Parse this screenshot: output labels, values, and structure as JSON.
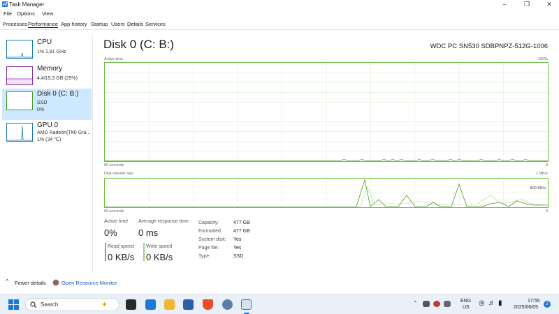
{
  "window": {
    "title": "Task Manager"
  },
  "menu": [
    "File",
    "Options",
    "View"
  ],
  "tabs": [
    "Processes",
    "Performance",
    "App history",
    "Startup",
    "Users",
    "Details",
    "Services"
  ],
  "sidebar": {
    "items": [
      {
        "name": "CPU",
        "lines": [
          "1%  1,81 GHz"
        ],
        "color": "#1779ba"
      },
      {
        "name": "Memory",
        "lines": [
          "4,4/15,3 GB (29%)"
        ],
        "color": "#8b2fa6"
      },
      {
        "name": "Disk 0 (C: B:)",
        "lines": [
          "SSD",
          "0%"
        ],
        "color": "#4e9a2a"
      },
      {
        "name": "GPU 0",
        "lines": [
          "AMD Radeon(TM) Gra...",
          "1%  (34 °C)"
        ],
        "color": "#1779ba"
      }
    ]
  },
  "disk": {
    "title": "Disk 0 (C: B:)",
    "model": "WDC PC SN530 SDBPNPZ-512G-1006",
    "active_graph": {
      "label": "Active time",
      "max_label": "100%",
      "min_label": "0",
      "time_label": "60 seconds",
      "values": [
        0,
        0,
        0,
        0,
        0,
        0,
        0,
        0,
        0,
        0,
        0,
        0,
        0,
        0,
        0,
        0,
        0,
        0,
        0,
        0,
        0,
        0,
        0,
        0,
        0,
        0,
        0,
        0,
        0,
        0,
        0,
        0,
        0,
        0,
        0,
        0,
        0,
        0,
        0,
        0,
        0,
        0,
        0,
        0,
        0,
        0,
        0,
        0,
        0,
        0,
        0,
        0,
        0,
        0,
        1,
        0,
        0,
        0,
        1,
        0,
        0,
        0,
        0,
        1,
        0,
        1,
        0,
        1,
        0,
        0,
        0,
        1,
        0,
        0,
        1,
        0,
        0,
        0,
        1,
        0,
        1,
        0,
        0,
        0,
        0,
        1,
        0,
        0,
        0,
        1,
        0,
        0,
        1,
        0,
        0,
        1,
        0,
        0,
        0,
        0,
        0
      ]
    },
    "transfer_graph": {
      "label": "Disk transfer rate",
      "max_label": "1 MB/s",
      "mid_label": "800 KB/s",
      "min_label": "0",
      "time_label": "60 seconds"
    },
    "stats": {
      "active_time_label": "Active time",
      "active_time_value": "0%",
      "avg_response_label": "Average response time",
      "avg_response_value": "0 ms",
      "read_label": "Read speed",
      "read_value": "0 KB/s",
      "write_label": "Write speed",
      "write_value": "0 KB/s"
    },
    "props": [
      {
        "k": "Capacity:",
        "v": "477 GB"
      },
      {
        "k": "Formatted:",
        "v": "477 GB"
      },
      {
        "k": "System disk:",
        "v": "Yes"
      },
      {
        "k": "Page file:",
        "v": "Yes"
      },
      {
        "k": "Type:",
        "v": "SSD"
      }
    ]
  },
  "footer": {
    "fewer": "Fewer details",
    "monitor": "Open Resource Monitor"
  },
  "taskbar": {
    "search_placeholder": "Search",
    "lang_top": "ENG",
    "lang_bottom": "US",
    "time": "17:55",
    "date": "2025/06/05",
    "notif_count": "2"
  }
}
